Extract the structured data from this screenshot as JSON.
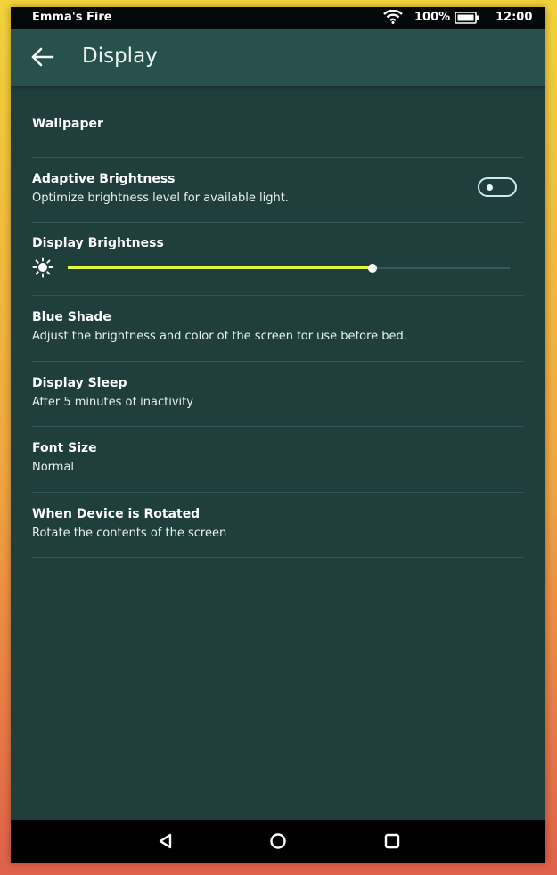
{
  "status_bar": {
    "device_name": "Emma's Fire",
    "battery_percent": "100%",
    "time": "12:00",
    "icons": [
      "wifi-icon",
      "battery-icon"
    ]
  },
  "app_bar": {
    "title": "Display",
    "back_icon": "arrow-left-icon"
  },
  "settings": {
    "wallpaper": {
      "label": "Wallpaper"
    },
    "adaptive_brightness": {
      "label": "Adaptive Brightness",
      "description": "Optimize brightness level for available light.",
      "enabled": false
    },
    "display_brightness": {
      "label": "Display Brightness",
      "icon": "sun-icon",
      "level": 0.69
    },
    "blue_shade": {
      "label": "Blue Shade",
      "description": "Adjust the brightness and color of the screen for use before bed."
    },
    "display_sleep": {
      "label": "Display Sleep",
      "description": "After 5 minutes of inactivity"
    },
    "font_size": {
      "label": "Font Size",
      "description": "Normal"
    },
    "rotation": {
      "label": "When Device is Rotated",
      "description": "Rotate the contents of the screen"
    }
  },
  "nav_bar": {
    "icons": [
      "back-triangle-icon",
      "home-circle-icon",
      "recents-square-icon"
    ]
  },
  "colors": {
    "background": "#1f3e3c",
    "app_bar": "#28504d",
    "slider_fill": "#dfff3a",
    "frame_top": "#f2d23a",
    "frame_bottom": "#e0604a"
  }
}
